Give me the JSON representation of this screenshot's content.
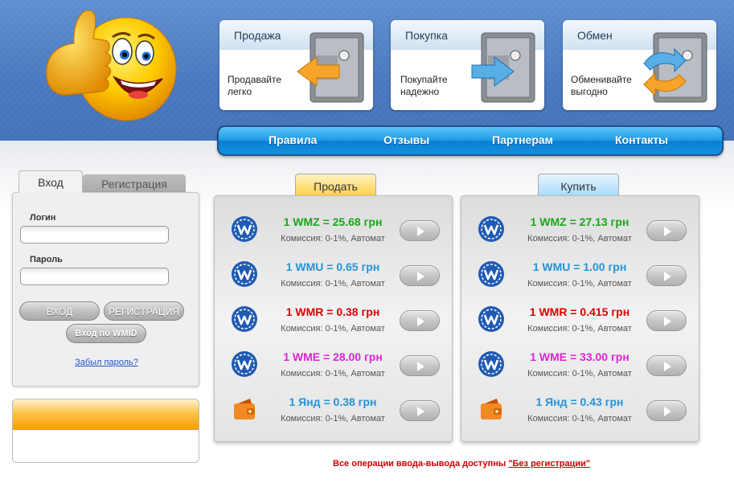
{
  "cards": [
    {
      "title": "Продажа",
      "line1": "Продавайте",
      "line2": "легко",
      "arrow": "orange-left-arrow-icon"
    },
    {
      "title": "Покупка",
      "line1": "Покупайте",
      "line2": "надежно",
      "arrow": "blue-right-arrow-icon"
    },
    {
      "title": "Обмен",
      "line1": "Обменивайте",
      "line2": "выгодно",
      "arrow": "exchange-arrows-icon"
    }
  ],
  "nav": [
    "Правила",
    "Отзывы",
    "Партнерам",
    "Контакты"
  ],
  "login": {
    "tab_login": "Вход",
    "tab_register": "Регистрация",
    "login_label": "Логин",
    "password_label": "Пароль",
    "login_value": "",
    "password_value": "",
    "login_button": "ВХОД",
    "register_button": "РЕГИСТРАЦИЯ",
    "wmid_button": "Вход по WMID",
    "forgot": "Забыл пароль?"
  },
  "sell": {
    "tab": "Продать",
    "rows": [
      {
        "rate": "1 WMZ = 25.68 грн",
        "fee": "Комиссия: 0-1%, Автомат",
        "icon": "webmoney-icon",
        "color": "#1aa61a"
      },
      {
        "rate": "1 WMU = 0.65 грн",
        "fee": "Комиссия: 0-1%, Автомат",
        "icon": "webmoney-icon",
        "color": "#2393d8"
      },
      {
        "rate": "1 WMR = 0.38 грн",
        "fee": "Комиссия: 0-1%, Автомат",
        "icon": "webmoney-icon",
        "color": "#e00000"
      },
      {
        "rate": "1 WME = 28.00 грн",
        "fee": "Комиссия: 0-1%, Автомат",
        "icon": "webmoney-icon",
        "color": "#e022d8"
      },
      {
        "rate": "1 Янд = 0.38 грн",
        "fee": "Комиссия: 0-1%, Автомат",
        "icon": "yandex-wallet-icon",
        "color": "#2393d8"
      }
    ]
  },
  "buy": {
    "tab": "Купить",
    "rows": [
      {
        "rate": "1 WMZ = 27.13 грн",
        "fee": "Комиссия: 0-1%, Автомат",
        "icon": "webmoney-icon",
        "color": "#1aa61a"
      },
      {
        "rate": "1 WMU = 1.00 грн",
        "fee": "Комиссия: 0-1%, Автомат",
        "icon": "webmoney-icon",
        "color": "#2393d8"
      },
      {
        "rate": "1 WMR = 0.415 грн",
        "fee": "Комиссия: 0-1%, Автомат",
        "icon": "webmoney-icon",
        "color": "#e00000"
      },
      {
        "rate": "1 WME = 33.00 грн",
        "fee": "Комиссия: 0-1%, Автомат",
        "icon": "webmoney-icon",
        "color": "#e022d8"
      },
      {
        "rate": "1 Янд = 0.43 грн",
        "fee": "Комиссия: 0-1%, Автомат",
        "icon": "yandex-wallet-icon",
        "color": "#2393d8"
      }
    ]
  },
  "notice": {
    "text": "Все операции ввода-вывода доступны ",
    "link": "\"Без регистрации\""
  }
}
